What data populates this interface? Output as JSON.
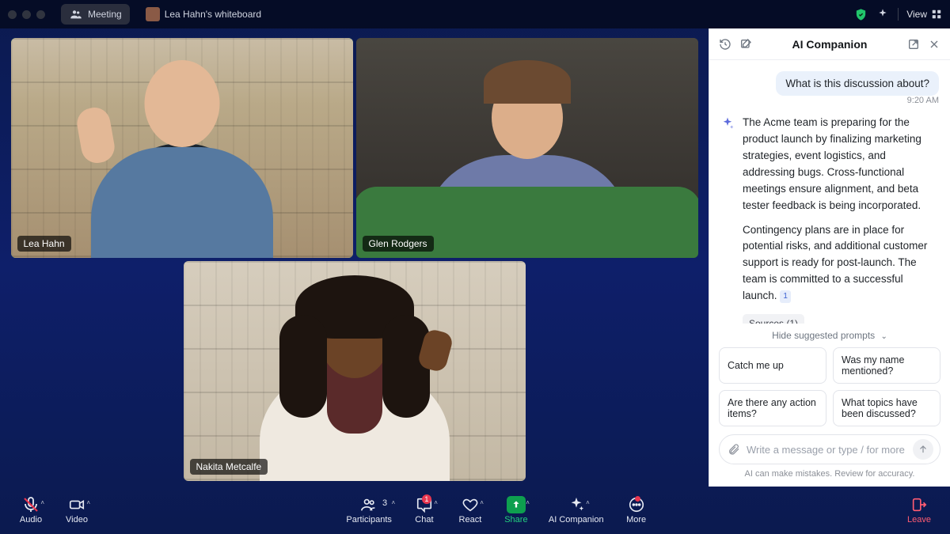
{
  "topbar": {
    "meeting_label": "Meeting",
    "whiteboard_label": "Lea Hahn's whiteboard",
    "view_label": "View"
  },
  "participants": [
    {
      "name": "Lea Hahn"
    },
    {
      "name": "Glen Rodgers"
    },
    {
      "name": "Nakita Metcalfe"
    }
  ],
  "controls": {
    "audio": "Audio",
    "video": "Video",
    "participants": "Participants",
    "participants_count": "3",
    "chat": "Chat",
    "chat_badge": "1",
    "react": "React",
    "share": "Share",
    "ai": "AI Companion",
    "more": "More",
    "leave": "Leave"
  },
  "ai": {
    "title": "AI Companion",
    "user_prompt": "What is this discussion about?",
    "time": "9:20 AM",
    "reply_p1": "The Acme team is preparing for the product launch by finalizing marketing strategies, event logistics, and addressing bugs. Cross-functional meetings ensure alignment, and beta tester feedback is being incorporated.",
    "reply_p2": "Contingency plans are in place for potential risks, and additional customer support is ready for post-launch. The team is committed to a successful launch.",
    "citation": "1",
    "sources_label": "Sources (1)",
    "hide_prompts": "Hide suggested prompts",
    "prompts": [
      "Catch me up",
      "Was my name mentioned?",
      "Are there any action items?",
      "What topics have been discussed?"
    ],
    "composer_placeholder": "Write a message or type / for more",
    "disclaimer": "AI can make mistakes. Review for accuracy."
  }
}
